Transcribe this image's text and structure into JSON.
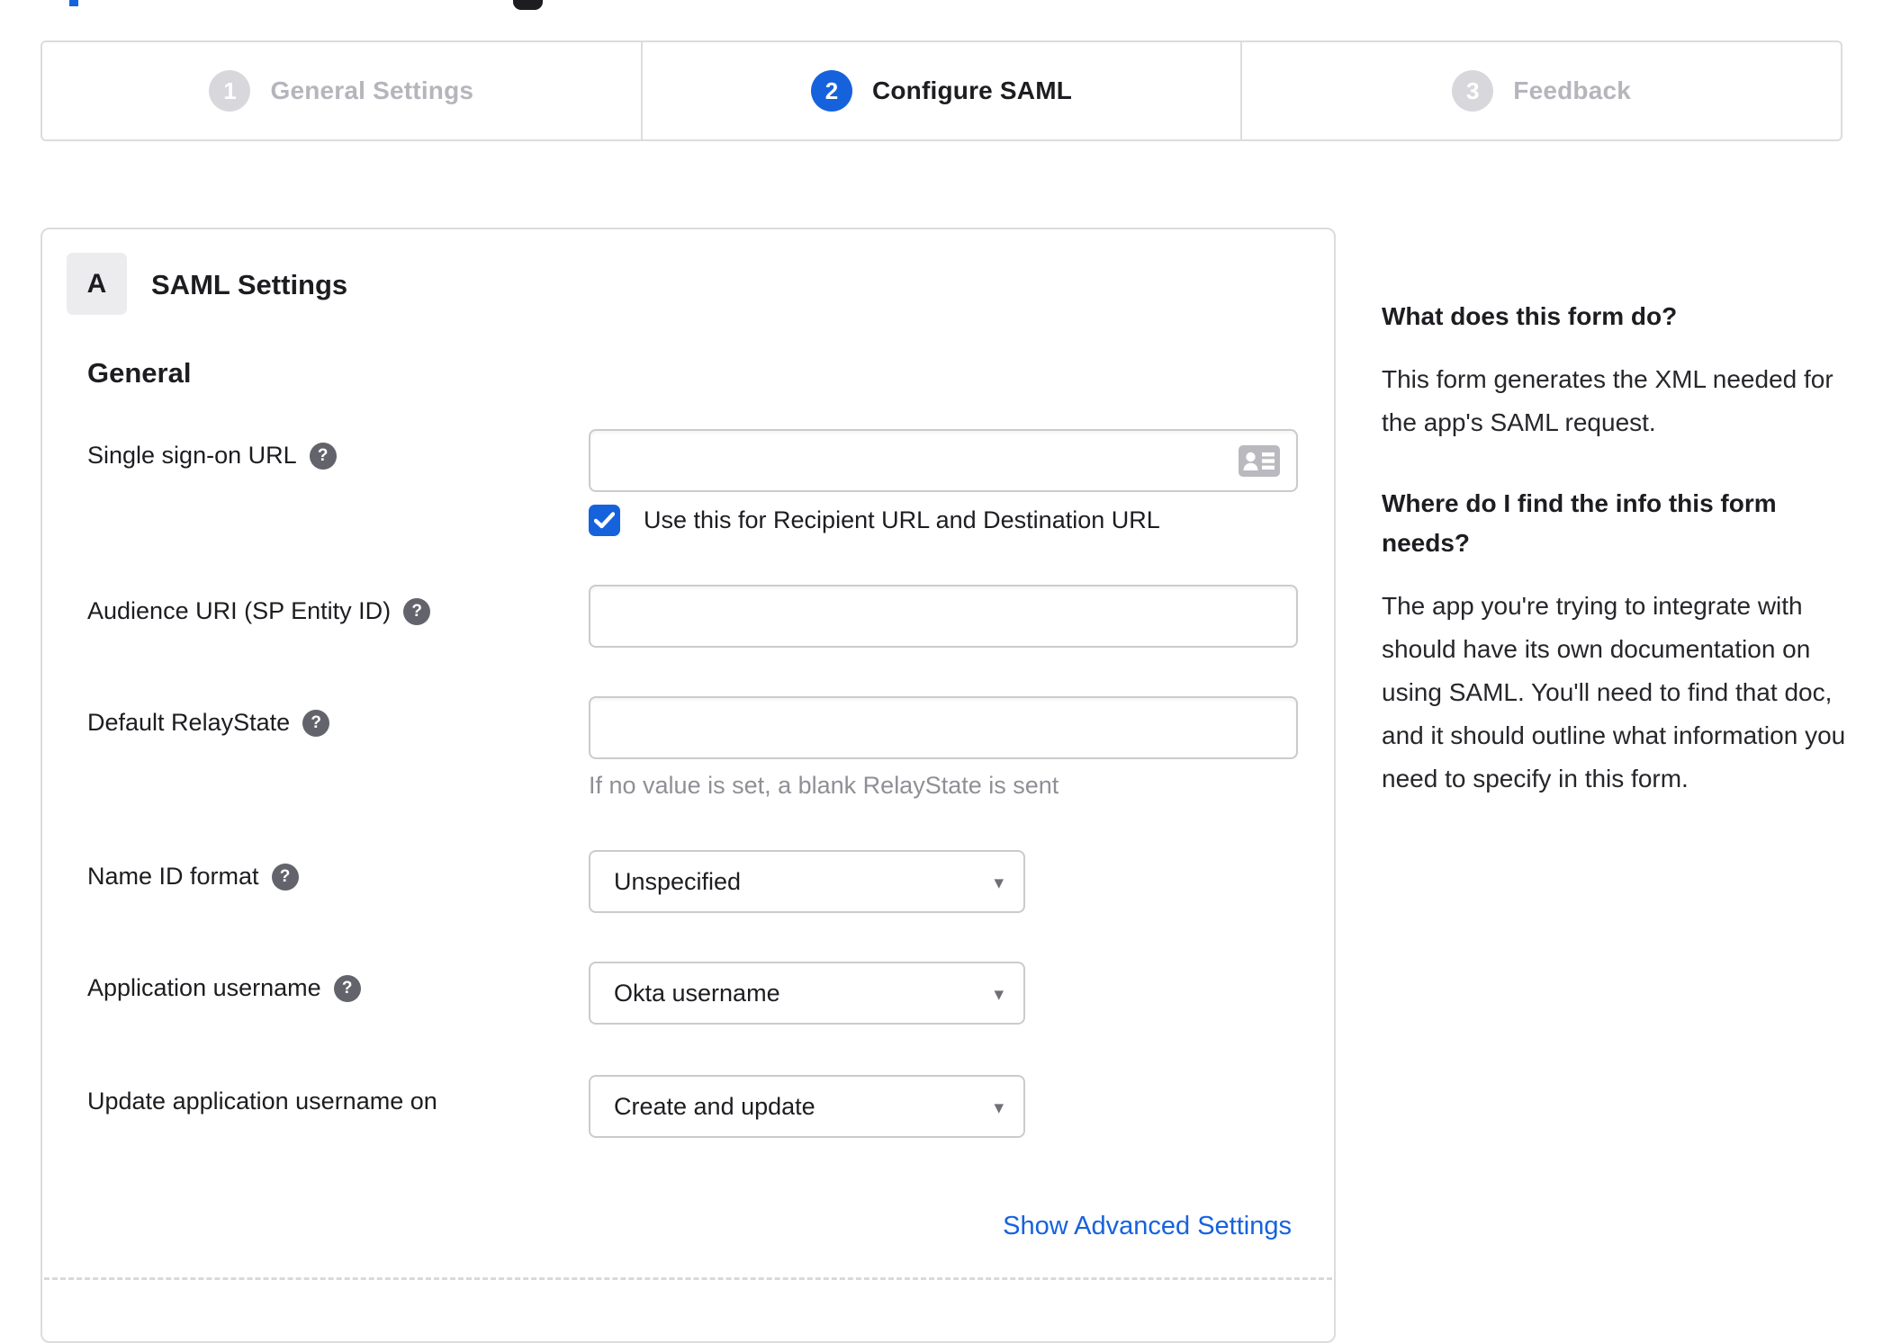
{
  "colors": {
    "accent_blue": "#1662dd",
    "text_dark": "#1d1d21",
    "muted_gray": "#8f8f96",
    "border_gray": "#dcdce0"
  },
  "icons": {
    "help": "?",
    "caret": "▾"
  },
  "stepper": {
    "steps": [
      {
        "number": "1",
        "label": "General Settings",
        "state": "inactive"
      },
      {
        "number": "2",
        "label": "Configure SAML",
        "state": "active"
      },
      {
        "number": "3",
        "label": "Feedback",
        "state": "inactive"
      }
    ]
  },
  "panel": {
    "section_badge": "A",
    "section_title": "SAML Settings",
    "group_title": "General",
    "fields": {
      "sso": {
        "label": "Single sign-on URL",
        "value": "",
        "checkbox_label": "Use this for Recipient URL and Destination URL",
        "checkbox_checked": true
      },
      "audience": {
        "label": "Audience URI (SP Entity ID)",
        "value": ""
      },
      "relay": {
        "label": "Default RelayState",
        "value": "",
        "hint": "If no value is set, a blank RelayState is sent"
      },
      "name_id": {
        "label": "Name ID format",
        "value": "Unspecified"
      },
      "app_username": {
        "label": "Application username",
        "value": "Okta username"
      },
      "update_username": {
        "label": "Update application username on",
        "value": "Create and update"
      }
    },
    "advanced_link": "Show Advanced Settings"
  },
  "sidebar": {
    "q1": "What does this form do?",
    "a1": "This form generates the XML needed for the app's SAML request.",
    "q2": "Where do I find the info this form needs?",
    "a2": "The app you're trying to integrate with should have its own documentation on using SAML. You'll need to find that doc, and it should outline what information you need to specify in this form."
  }
}
